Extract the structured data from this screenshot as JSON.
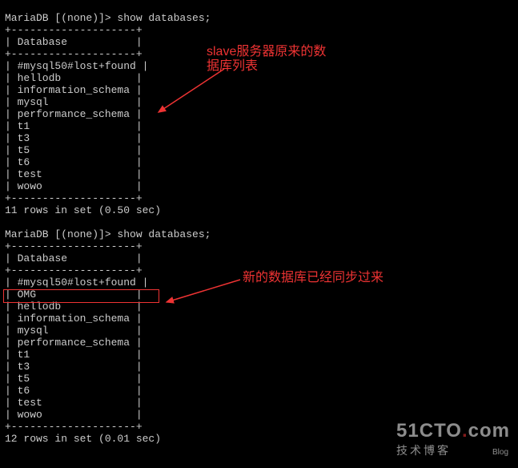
{
  "block1": {
    "prompt": "MariaDB [(none)]> show databases;",
    "sep": "+--------------------+",
    "header": "| Database           |",
    "rows": [
      "| #mysql50#lost+found |",
      "| hellodb            |",
      "| information_schema |",
      "| mysql              |",
      "| performance_schema |",
      "| t1                 |",
      "| t3                 |",
      "| t5                 |",
      "| t6                 |",
      "| test               |",
      "| wowo               |"
    ],
    "footer": "11 rows in set (0.50 sec)"
  },
  "block2": {
    "prompt": "MariaDB [(none)]> show databases;",
    "sep": "+--------------------+",
    "header": "| Database           |",
    "rows": [
      "| #mysql50#lost+found |",
      "| OMG                |",
      "| hellodb            |",
      "| information_schema |",
      "| mysql              |",
      "| performance_schema |",
      "| t1                 |",
      "| t3                 |",
      "| t5                 |",
      "| t6                 |",
      "| test               |",
      "| wowo               |"
    ],
    "footer": "12 rows in set (0.01 sec)"
  },
  "annotation1_line1": "slave服务器原来的数",
  "annotation1_line2": "据库列表",
  "annotation2": "新的数据库已经同步过来",
  "watermark_main_a": "51CTO",
  "watermark_main_b": "com",
  "watermark_sub": "技术博客",
  "watermark_blog": "Blog"
}
